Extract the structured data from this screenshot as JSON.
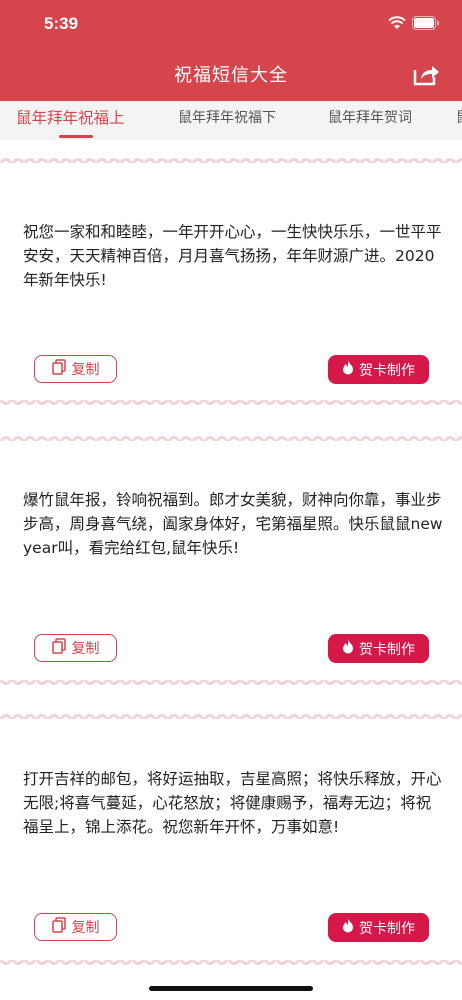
{
  "status_bar": {
    "time": "5:39"
  },
  "header": {
    "title": "祝福短信大全"
  },
  "tabs": [
    {
      "label": "鼠年拜年祝福上",
      "active": true
    },
    {
      "label": "鼠年拜年祝福下",
      "active": false
    },
    {
      "label": "鼠年拜年贺词",
      "active": false
    },
    {
      "label": "鼠",
      "active": false
    }
  ],
  "messages": [
    {
      "text": "祝您一家和和睦睦，一年开开心心，一生快快乐乐，一世平平安安，天天精神百倍，月月喜气扬扬，年年财源广进。2020年新年快乐!"
    },
    {
      "text": "爆竹鼠年报，铃响祝福到。郎才女美貌，财神向你靠，事业步步高，周身喜气绕，阖家身体好，宅第福星照。快乐鼠鼠new year叫，看完给红包,鼠年快乐!"
    },
    {
      "text": "打开吉祥的邮包，将好运抽取，吉星高照；将快乐释放，开心无限;将喜气蔓延，心花怒放；将健康赐予，福寿无边；将祝福呈上，锦上添花。祝您新年开怀，万事如意!"
    }
  ],
  "actions": {
    "copy_label": "复制",
    "card_label": "贺卡制作"
  },
  "colors": {
    "primary": "#d6454c",
    "button": "#d6174a"
  }
}
